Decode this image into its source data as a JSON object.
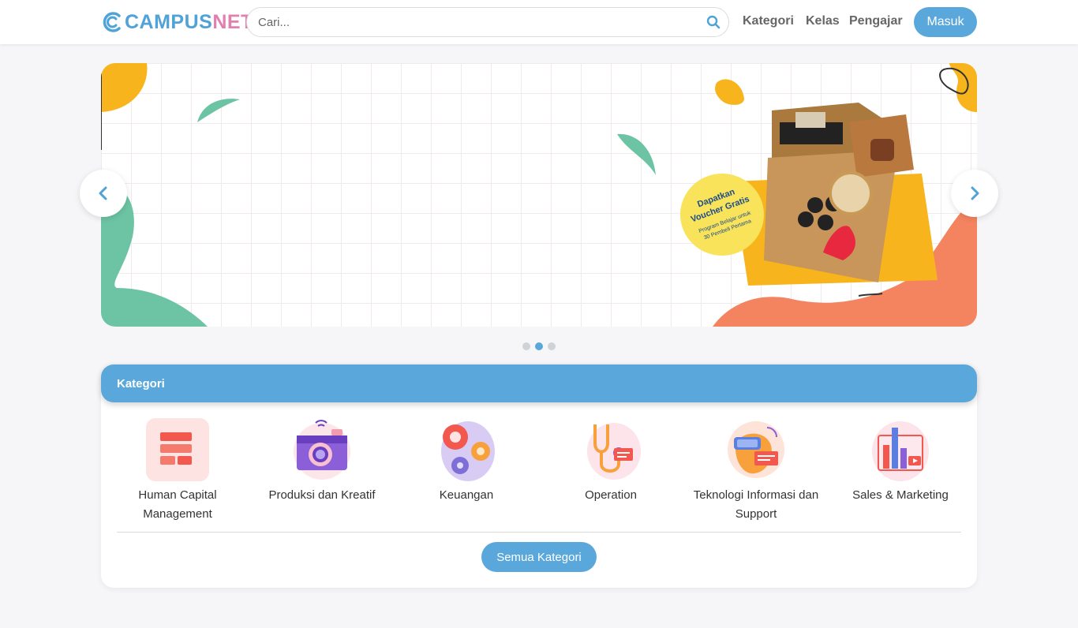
{
  "brand": {
    "part1": "CAMPUS",
    "part2": "NET"
  },
  "search": {
    "placeholder": "Cari..."
  },
  "nav": {
    "kategori": "Kategori",
    "kelas": "Kelas",
    "pengajar": "Pengajar",
    "login": "Masuk"
  },
  "banner": {
    "badge_line1": "Dapatkan",
    "badge_line2": "Voucher Gratis",
    "badge_line3": "Program Belajar untuk",
    "badge_line4": "30 Pembeli Pertama",
    "slides": 3,
    "active_slide": 2
  },
  "categories": {
    "title": "Kategori",
    "items": [
      {
        "label": "Human Capital Management",
        "icon": "grid-icon"
      },
      {
        "label": "Produksi dan Kreatif",
        "icon": "camera-icon"
      },
      {
        "label": "Keuangan",
        "icon": "gears-icon"
      },
      {
        "label": "Operation",
        "icon": "stethoscope-icon"
      },
      {
        "label": "Teknologi Informasi dan Support",
        "icon": "vr-headset-icon"
      },
      {
        "label": "Sales & Marketing",
        "icon": "marketing-chart-icon"
      }
    ],
    "all_button": "Semua Kategori"
  },
  "colors": {
    "accent": "#5aa8db",
    "brand_pink": "#e07fb0",
    "blob_green": "#6cc4a4",
    "blob_orange": "#f4845f",
    "blob_yellow": "#f8b41c"
  }
}
